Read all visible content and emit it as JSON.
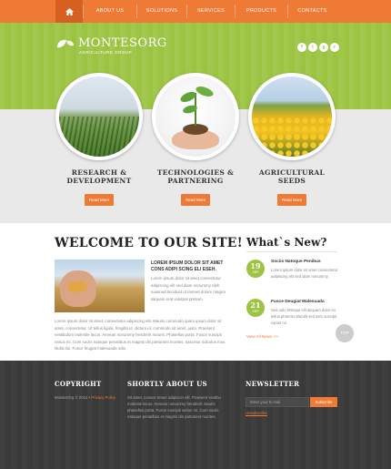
{
  "nav": {
    "items": [
      "ABOUT US",
      "SOLUTIONS",
      "SERVICES",
      "PRODUCTS",
      "CONTACTS"
    ]
  },
  "brand": {
    "name": "MONTESORG",
    "tagline": "AGRICULTURE GROUP"
  },
  "social": [
    "f",
    "t",
    "g",
    "r"
  ],
  "features": [
    {
      "title_line1": "RESEARCH &",
      "title_line2": "DEVELOPMENT",
      "button": "Read More"
    },
    {
      "title_line1": "TECHNOLOGIES &",
      "title_line2": "PARTNERING",
      "button": "Read More"
    },
    {
      "title_line1": "AGRICULTURAL",
      "title_line2": "SEEDS",
      "button": "Read More"
    }
  ],
  "welcome": {
    "title": "WELCOME TO OUR SITE!",
    "lead": "LOREM IPSUM DOLOR SIT AMET CONS ADIPI SCING ELI ESEH.",
    "para1": "Lorem ipsum dolor sit amet consectetur adipiscing elit sed diam nonummy nibh euismod tincidunt ut laoreet dolore magna aliquam erat volutpat pretium.",
    "para2": "Lorem ipsum dolor sit amet, consectetur adipiscing elit. Mauris commodo quam ipsum dolor sit amet, consectetur. Ut tellus ligula, fringilla ut, dictum et, commodo sit amet, justo. Praesent vestibulum molestie lacus. Aenean nonummy hendrerit mauris. Phasellus porta. Fusce suscipit varius mi. Cum sociis natoque penatibus et magnis dis parturient montes, nascetur ridiculus mus. Nulla dui. Fusce feugiat malesuada odio."
  },
  "news": {
    "title": "What`s New?",
    "items": [
      {
        "day": "19",
        "month": "SEP",
        "title": "Sociis Natoque Penibus",
        "text": "Lorem ipsum dolor sit amet consectetur adipiscing elit sed diam nonummy."
      },
      {
        "day": "21",
        "month": "SEP",
        "title": "Fusce Deugiat Malesuada",
        "text": "Sed odio tristique elit aliquam dolor eu tellus pharetra blandit sed sem suscipit varius mi."
      }
    ],
    "view_all": "View All News >>"
  },
  "top_label": "TOP",
  "footer": {
    "copyright_title": "COPYRIGHT",
    "copyright_text": "MontesOrg © 2012 •",
    "privacy": "Privacy Policy",
    "about_title": "SHORTLY ABOUT US",
    "about_text": "Sit amet, consec tetuer adipiscin elit. Praesent vestibu molestie lacus. Aenean nonummy hendrerit mauris phasellus porta. Fusce suscipit varius mi. Cum sociis natoque penatibus et magnis dis parturient montes.",
    "newsletter_title": "NEWSLETTER",
    "email_placeholder": "Enter your E-mail",
    "subscribe": "Subscribe",
    "unsubscribe": "Unsubscribe"
  },
  "colors": {
    "accent": "#ee7a36",
    "green": "#9cc442",
    "footer": "#3a3a3a"
  }
}
